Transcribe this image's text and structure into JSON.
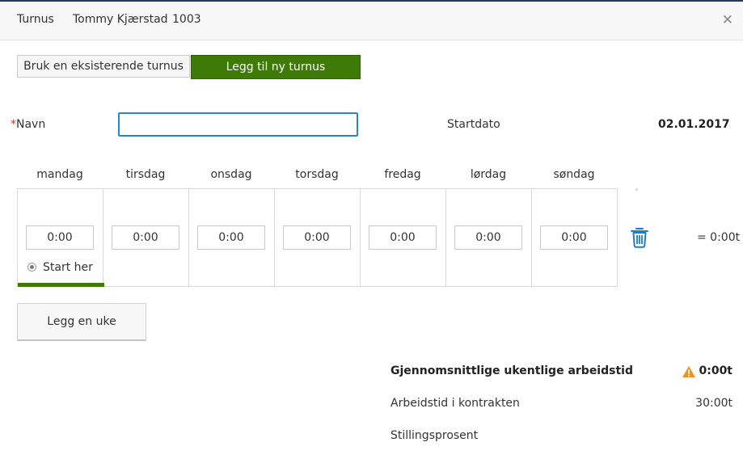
{
  "header": {
    "title": "Turnus",
    "employee_name": "Tommy Kjærstad",
    "employee_id": "1003",
    "close_icon": "close-icon"
  },
  "toggle": {
    "existing_label": "Bruk en eksisterende turnus",
    "new_label": "Legg til ny turnus",
    "active_color": "#3d7a06"
  },
  "form": {
    "required_marker": "*",
    "name_label": "Navn",
    "name_value": "",
    "start_date_label": "Startdato",
    "start_date_value": "02.01.2017"
  },
  "week": {
    "days": [
      "mandag",
      "tirsdag",
      "onsdag",
      "torsdag",
      "fredag",
      "lørdag",
      "søndag"
    ],
    "times": [
      "0:00",
      "0:00",
      "0:00",
      "0:00",
      "0:00",
      "0:00",
      "0:00"
    ],
    "start_here_label": "Start her",
    "delete_icon": "trash-icon",
    "week_total": "= 0:00t"
  },
  "actions": {
    "add_week_label": "Legg en uke"
  },
  "summary": {
    "avg_label": "Gjennomsnittlige ukentlige arbeidstid",
    "avg_value": "0:00t",
    "warning_icon": "warning-icon",
    "warning_color": "#f0921e",
    "contract_label": "Arbeidstid i kontrakten",
    "contract_value": "30:00t",
    "percent_label": "Stillingsprosent"
  }
}
